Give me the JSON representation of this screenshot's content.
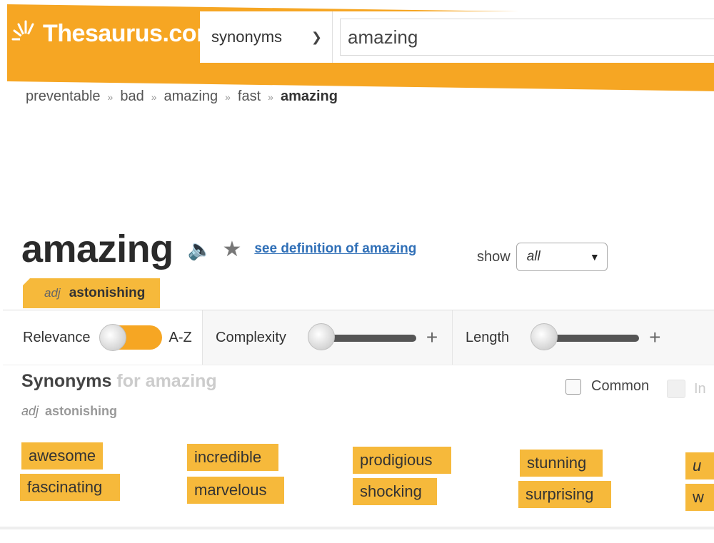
{
  "header": {
    "logo_text": "Thesaurus.com",
    "search_type": "synonyms",
    "search_value": "amazing"
  },
  "breadcrumb": [
    "preventable",
    "bad",
    "amazing",
    "fast",
    "amazing"
  ],
  "entry": {
    "headword": "amazing",
    "definition_link": "see definition of amazing",
    "show_label": "show",
    "show_value": "all"
  },
  "sense_tab": {
    "pos": "adj",
    "sense": "astonishing"
  },
  "filters": {
    "relevance": "Relevance",
    "az": "A-Z",
    "complexity": "Complexity",
    "length": "Length",
    "plus": "+"
  },
  "synonyms": {
    "heading": "Synonyms",
    "for_text": "for amazing",
    "pos": "adj",
    "sense": "astonishing",
    "common_label": "Common",
    "informal_label": "In",
    "chips": [
      "awesome",
      "fascinating",
      "incredible",
      "marvelous",
      "prodigious",
      "shocking",
      "stunning",
      "surprising",
      "u",
      "w"
    ]
  },
  "colors": {
    "brand_orange": "#f6a623",
    "chip": "#f6b93b",
    "link": "#2f6fb7"
  }
}
